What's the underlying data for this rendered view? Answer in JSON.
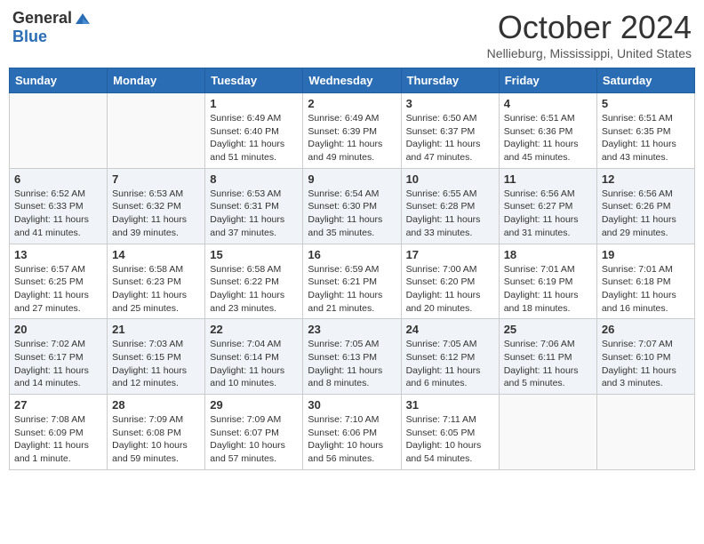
{
  "logo": {
    "general": "General",
    "blue": "Blue"
  },
  "title": "October 2024",
  "subtitle": "Nellieburg, Mississippi, United States",
  "days_of_week": [
    "Sunday",
    "Monday",
    "Tuesday",
    "Wednesday",
    "Thursday",
    "Friday",
    "Saturday"
  ],
  "weeks": [
    [
      {
        "day": "",
        "sunrise": "",
        "sunset": "",
        "daylight": ""
      },
      {
        "day": "",
        "sunrise": "",
        "sunset": "",
        "daylight": ""
      },
      {
        "day": "1",
        "sunrise": "Sunrise: 6:49 AM",
        "sunset": "Sunset: 6:40 PM",
        "daylight": "Daylight: 11 hours and 51 minutes."
      },
      {
        "day": "2",
        "sunrise": "Sunrise: 6:49 AM",
        "sunset": "Sunset: 6:39 PM",
        "daylight": "Daylight: 11 hours and 49 minutes."
      },
      {
        "day": "3",
        "sunrise": "Sunrise: 6:50 AM",
        "sunset": "Sunset: 6:37 PM",
        "daylight": "Daylight: 11 hours and 47 minutes."
      },
      {
        "day": "4",
        "sunrise": "Sunrise: 6:51 AM",
        "sunset": "Sunset: 6:36 PM",
        "daylight": "Daylight: 11 hours and 45 minutes."
      },
      {
        "day": "5",
        "sunrise": "Sunrise: 6:51 AM",
        "sunset": "Sunset: 6:35 PM",
        "daylight": "Daylight: 11 hours and 43 minutes."
      }
    ],
    [
      {
        "day": "6",
        "sunrise": "Sunrise: 6:52 AM",
        "sunset": "Sunset: 6:33 PM",
        "daylight": "Daylight: 11 hours and 41 minutes."
      },
      {
        "day": "7",
        "sunrise": "Sunrise: 6:53 AM",
        "sunset": "Sunset: 6:32 PM",
        "daylight": "Daylight: 11 hours and 39 minutes."
      },
      {
        "day": "8",
        "sunrise": "Sunrise: 6:53 AM",
        "sunset": "Sunset: 6:31 PM",
        "daylight": "Daylight: 11 hours and 37 minutes."
      },
      {
        "day": "9",
        "sunrise": "Sunrise: 6:54 AM",
        "sunset": "Sunset: 6:30 PM",
        "daylight": "Daylight: 11 hours and 35 minutes."
      },
      {
        "day": "10",
        "sunrise": "Sunrise: 6:55 AM",
        "sunset": "Sunset: 6:28 PM",
        "daylight": "Daylight: 11 hours and 33 minutes."
      },
      {
        "day": "11",
        "sunrise": "Sunrise: 6:56 AM",
        "sunset": "Sunset: 6:27 PM",
        "daylight": "Daylight: 11 hours and 31 minutes."
      },
      {
        "day": "12",
        "sunrise": "Sunrise: 6:56 AM",
        "sunset": "Sunset: 6:26 PM",
        "daylight": "Daylight: 11 hours and 29 minutes."
      }
    ],
    [
      {
        "day": "13",
        "sunrise": "Sunrise: 6:57 AM",
        "sunset": "Sunset: 6:25 PM",
        "daylight": "Daylight: 11 hours and 27 minutes."
      },
      {
        "day": "14",
        "sunrise": "Sunrise: 6:58 AM",
        "sunset": "Sunset: 6:23 PM",
        "daylight": "Daylight: 11 hours and 25 minutes."
      },
      {
        "day": "15",
        "sunrise": "Sunrise: 6:58 AM",
        "sunset": "Sunset: 6:22 PM",
        "daylight": "Daylight: 11 hours and 23 minutes."
      },
      {
        "day": "16",
        "sunrise": "Sunrise: 6:59 AM",
        "sunset": "Sunset: 6:21 PM",
        "daylight": "Daylight: 11 hours and 21 minutes."
      },
      {
        "day": "17",
        "sunrise": "Sunrise: 7:00 AM",
        "sunset": "Sunset: 6:20 PM",
        "daylight": "Daylight: 11 hours and 20 minutes."
      },
      {
        "day": "18",
        "sunrise": "Sunrise: 7:01 AM",
        "sunset": "Sunset: 6:19 PM",
        "daylight": "Daylight: 11 hours and 18 minutes."
      },
      {
        "day": "19",
        "sunrise": "Sunrise: 7:01 AM",
        "sunset": "Sunset: 6:18 PM",
        "daylight": "Daylight: 11 hours and 16 minutes."
      }
    ],
    [
      {
        "day": "20",
        "sunrise": "Sunrise: 7:02 AM",
        "sunset": "Sunset: 6:17 PM",
        "daylight": "Daylight: 11 hours and 14 minutes."
      },
      {
        "day": "21",
        "sunrise": "Sunrise: 7:03 AM",
        "sunset": "Sunset: 6:15 PM",
        "daylight": "Daylight: 11 hours and 12 minutes."
      },
      {
        "day": "22",
        "sunrise": "Sunrise: 7:04 AM",
        "sunset": "Sunset: 6:14 PM",
        "daylight": "Daylight: 11 hours and 10 minutes."
      },
      {
        "day": "23",
        "sunrise": "Sunrise: 7:05 AM",
        "sunset": "Sunset: 6:13 PM",
        "daylight": "Daylight: 11 hours and 8 minutes."
      },
      {
        "day": "24",
        "sunrise": "Sunrise: 7:05 AM",
        "sunset": "Sunset: 6:12 PM",
        "daylight": "Daylight: 11 hours and 6 minutes."
      },
      {
        "day": "25",
        "sunrise": "Sunrise: 7:06 AM",
        "sunset": "Sunset: 6:11 PM",
        "daylight": "Daylight: 11 hours and 5 minutes."
      },
      {
        "day": "26",
        "sunrise": "Sunrise: 7:07 AM",
        "sunset": "Sunset: 6:10 PM",
        "daylight": "Daylight: 11 hours and 3 minutes."
      }
    ],
    [
      {
        "day": "27",
        "sunrise": "Sunrise: 7:08 AM",
        "sunset": "Sunset: 6:09 PM",
        "daylight": "Daylight: 11 hours and 1 minute."
      },
      {
        "day": "28",
        "sunrise": "Sunrise: 7:09 AM",
        "sunset": "Sunset: 6:08 PM",
        "daylight": "Daylight: 10 hours and 59 minutes."
      },
      {
        "day": "29",
        "sunrise": "Sunrise: 7:09 AM",
        "sunset": "Sunset: 6:07 PM",
        "daylight": "Daylight: 10 hours and 57 minutes."
      },
      {
        "day": "30",
        "sunrise": "Sunrise: 7:10 AM",
        "sunset": "Sunset: 6:06 PM",
        "daylight": "Daylight: 10 hours and 56 minutes."
      },
      {
        "day": "31",
        "sunrise": "Sunrise: 7:11 AM",
        "sunset": "Sunset: 6:05 PM",
        "daylight": "Daylight: 10 hours and 54 minutes."
      },
      {
        "day": "",
        "sunrise": "",
        "sunset": "",
        "daylight": ""
      },
      {
        "day": "",
        "sunrise": "",
        "sunset": "",
        "daylight": ""
      }
    ]
  ]
}
